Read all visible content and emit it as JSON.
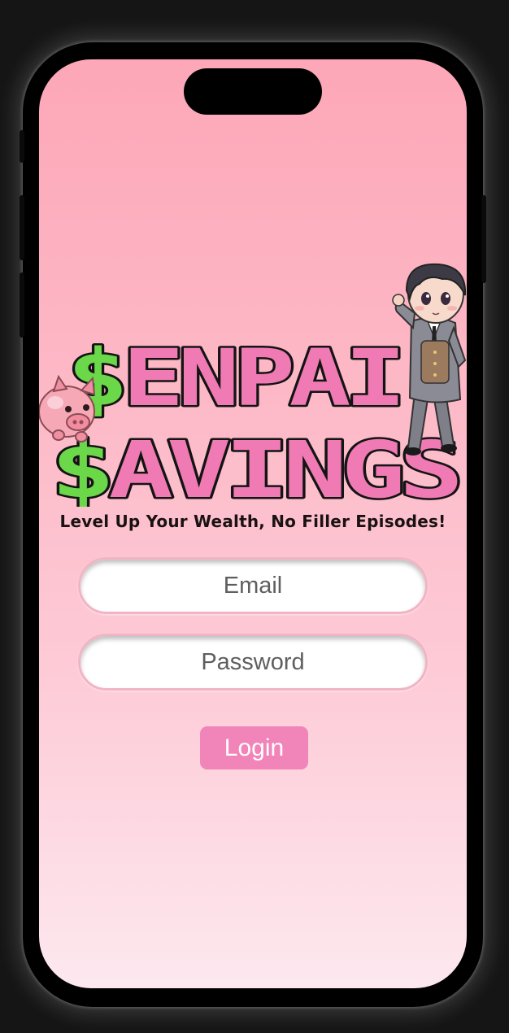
{
  "app": {
    "logo_line1": "$ENPAI",
    "logo_line2": "$AVINGS",
    "tagline": "Level Up Your Wealth, No Filler Episodes!"
  },
  "form": {
    "email_placeholder": "Email",
    "email_value": "",
    "password_placeholder": "Password",
    "password_value": "",
    "login_label": "Login"
  },
  "colors": {
    "gradient_top": "#fda7b8",
    "gradient_bottom": "#fde8ef",
    "logo_pink": "#f07ab3",
    "logo_green": "#6bd84a",
    "button": "#f184b8"
  },
  "icons": [
    "piggy-bank-icon",
    "chibi-businessman-illustration"
  ]
}
